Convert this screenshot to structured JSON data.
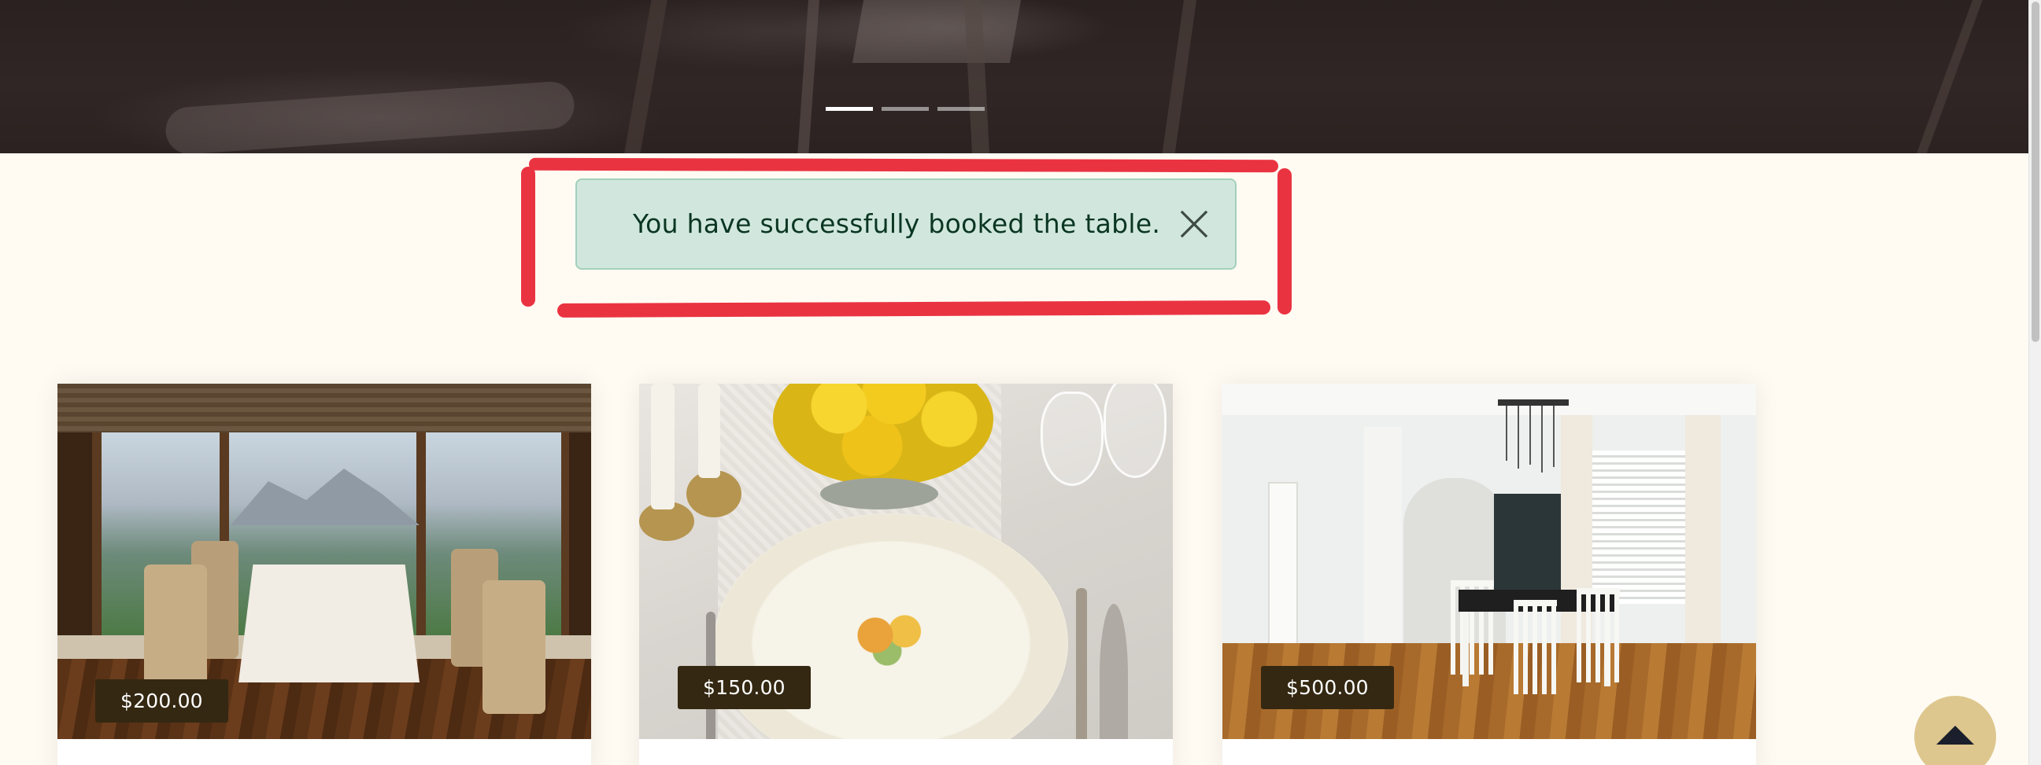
{
  "carousel": {
    "indicators": [
      {
        "label": "slide-1",
        "active": true
      },
      {
        "label": "slide-2",
        "active": false
      },
      {
        "label": "slide-3",
        "active": false
      }
    ]
  },
  "alert": {
    "message": "You have successfully booked the table.",
    "type": "success",
    "close_icon": "close-icon",
    "highlight_color": "#ea3341"
  },
  "cards": [
    {
      "price": "$200.00",
      "image": "restaurant-window-table"
    },
    {
      "price": "$150.00",
      "image": "place-setting-yellow-roses"
    },
    {
      "price": "$500.00",
      "image": "dining-room-interior"
    }
  ],
  "colors": {
    "page_background": "#fffbf3",
    "alert_background": "#d1e7dd",
    "alert_text": "#0a3622",
    "price_badge": "#342812",
    "back_to_top": "#dec78e"
  },
  "back_to_top": {
    "icon": "chevron-up-icon"
  }
}
